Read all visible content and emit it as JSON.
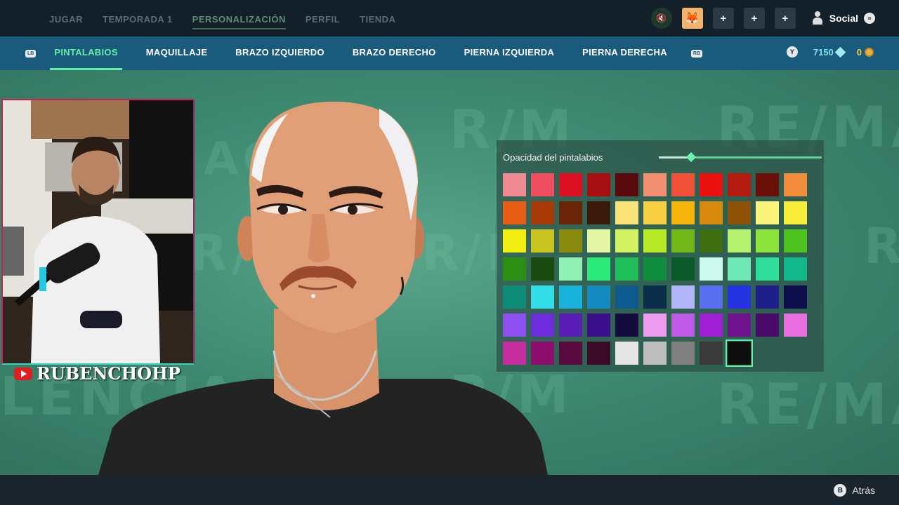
{
  "top_nav": {
    "tabs": [
      {
        "label": "JUGAR"
      },
      {
        "label": "TEMPORADA 1"
      },
      {
        "label": "PERSONALIZACIÓN",
        "active": true
      },
      {
        "label": "PERFIL"
      },
      {
        "label": "TIENDA"
      }
    ],
    "social_label": "Social",
    "plus_icon": "+"
  },
  "sub_nav": {
    "left_bumper": "LB",
    "right_bumper": "RB",
    "tabs": [
      {
        "label": "PINTALABIOS",
        "active": true
      },
      {
        "label": "MAQUILLAJE"
      },
      {
        "label": "BRAZO IZQUIERDO"
      },
      {
        "label": "BRAZO DERECHO"
      },
      {
        "label": "PIERNA IZQUIERDA"
      },
      {
        "label": "PIERNA DERECHA"
      }
    ]
  },
  "currency": {
    "button": "Y",
    "premium": "7150",
    "coins": "0"
  },
  "background_words": [
    "AG",
    "R/M",
    "RE/MA",
    "R/M",
    "R/M",
    "RE/MA",
    "LENCIA",
    "R/M",
    "RE/MA"
  ],
  "webcam": {
    "channel_name": "RUBENCHOHP"
  },
  "lipstick_panel": {
    "opacity_label": "Opacidad del pintalabios",
    "opacity_value": 0.2,
    "selected_index": 74,
    "swatches": [
      "#f08a92",
      "#ef4d60",
      "#dd0f22",
      "#a60e12",
      "#5a0a0c",
      "#f49072",
      "#f2513a",
      "#ec1010",
      "#b31a10",
      "#6a0e08",
      "#f08c3c",
      "#e85e16",
      "#a83a08",
      "#6a2408",
      "#3c1a0a",
      "#fbe37a",
      "#f7cf42",
      "#f5b40a",
      "#d88a0e",
      "#8e5206",
      "#fbf47a",
      "#f8ee3a",
      "#f0ee12",
      "#c8c61e",
      "#8a8a0e",
      "#e4f6a4",
      "#d4f262",
      "#b6ea26",
      "#72b81a",
      "#3e6e10",
      "#b6f270",
      "#8ee23c",
      "#4ec21e",
      "#2c8e12",
      "#1a4a0e",
      "#8ff0b4",
      "#2bea7a",
      "#1ebe5a",
      "#0e8e3e",
      "#0a5a2a",
      "#ccf8ee",
      "#6ee8b6",
      "#2ede9a",
      "#12b889",
      "#0e8c78",
      "#32dde6",
      "#18b2dc",
      "#138ac0",
      "#0c5a8e",
      "#0a2e48",
      "#b0b6f6",
      "#5a6ef0",
      "#2532e0",
      "#1e1e8a",
      "#0e0e4c",
      "#8e50f0",
      "#6e2cdc",
      "#5a1eb6",
      "#3a0e8a",
      "#140c3c",
      "#ee9cf0",
      "#c05ae8",
      "#a01ed6",
      "#6e128e",
      "#4a0a6a",
      "#e86ee0",
      "#c62ea0",
      "#8e0e6e",
      "#5a0a3e",
      "#3a0a26",
      "#e6e6e6",
      "#bdbdbd",
      "#808080",
      "#3a3a3a",
      "#0e0e0e"
    ]
  },
  "footer": {
    "back_button": "B",
    "back_label": "Atrás"
  },
  "colors": {
    "accent": "#62f0a8",
    "subnav_bg": "#1a5b7d",
    "topbar_bg": "#13202a"
  }
}
